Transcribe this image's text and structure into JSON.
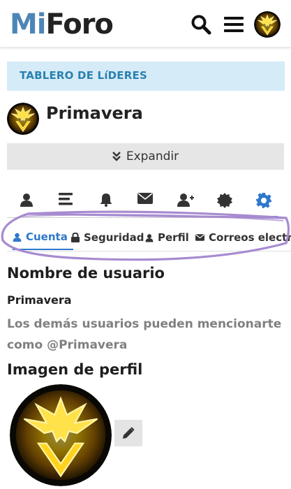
{
  "header": {
    "logo_part1": "Mi",
    "logo_part2": "Foro",
    "icons": [
      "search-icon",
      "menu-icon",
      "user-avatar"
    ]
  },
  "banner": {
    "label": "TABLERO DE LíDERES"
  },
  "profile": {
    "name": "Primavera"
  },
  "expand_button": {
    "label": "Expandir",
    "icon": "double-chevron-down-icon"
  },
  "icon_tabs": [
    {
      "icon": "user-icon",
      "active": false
    },
    {
      "icon": "list-icon",
      "active": false
    },
    {
      "icon": "bell-icon",
      "active": false
    },
    {
      "icon": "envelope-icon",
      "active": false
    },
    {
      "icon": "user-plus-icon",
      "active": false
    },
    {
      "icon": "badge-icon",
      "active": false
    },
    {
      "icon": "gear-icon",
      "active": true
    }
  ],
  "sub_tabs": [
    {
      "label": "Cuenta",
      "icon": "user-icon",
      "active": true
    },
    {
      "label": "Seguridad",
      "icon": "lock-icon",
      "active": false
    },
    {
      "label": "Perfil",
      "icon": "user-icon",
      "active": false
    },
    {
      "label": "Correos electró",
      "icon": "envelope-icon",
      "active": false
    }
  ],
  "username_section": {
    "title": "Nombre de usuario",
    "value": "Primavera",
    "hint": "Los demás usuarios pueden mencionarte como @Primavera"
  },
  "avatar_section": {
    "title": "Imagen de perfil",
    "edit_icon": "pencil-icon"
  },
  "colors": {
    "accent": "#2e78cc",
    "banner_bg": "#d5ecf8",
    "banner_text": "#2b80b0",
    "annotation": "#a78bd0",
    "avatar_glow": "#f5c400"
  }
}
